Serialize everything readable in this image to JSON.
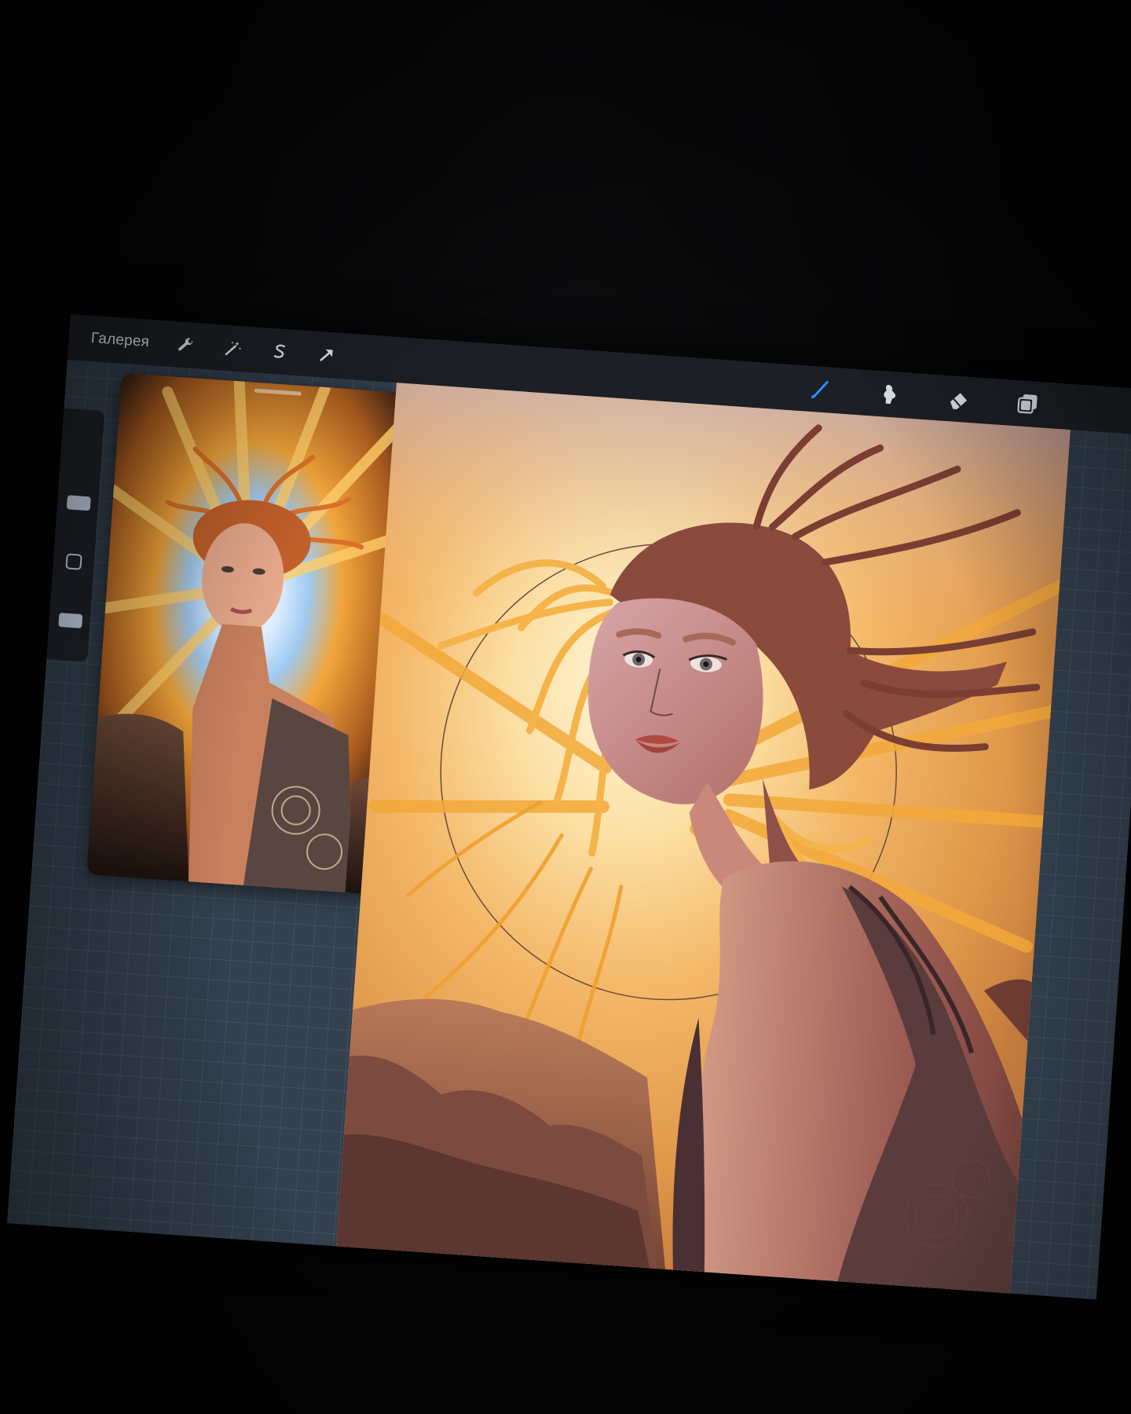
{
  "toolbar": {
    "gallery_label": "Галерея",
    "left_tools": [
      {
        "name": "actions",
        "icon": "wrench-icon"
      },
      {
        "name": "adjustments",
        "icon": "magic-wand-icon"
      },
      {
        "name": "selection",
        "icon": "selection-s-icon"
      },
      {
        "name": "transform",
        "icon": "arrow-icon"
      }
    ],
    "right_tools": [
      {
        "name": "brush",
        "icon": "brush-icon",
        "active": true
      },
      {
        "name": "smudge",
        "icon": "smudge-icon",
        "active": false
      },
      {
        "name": "eraser",
        "icon": "eraser-icon",
        "active": false
      },
      {
        "name": "layers",
        "icon": "layers-icon",
        "active": false
      }
    ],
    "active_color": "#2f8cff"
  },
  "sidebar": {
    "controls": [
      "brush-size-slider",
      "modify-button",
      "opacity-slider"
    ]
  },
  "colors": {
    "toolbar_bg": "#1c1f25",
    "canvas_bg_grid": "#33404e",
    "icon_default": "#dfe6f0",
    "icon_active": "#2f8cff"
  }
}
